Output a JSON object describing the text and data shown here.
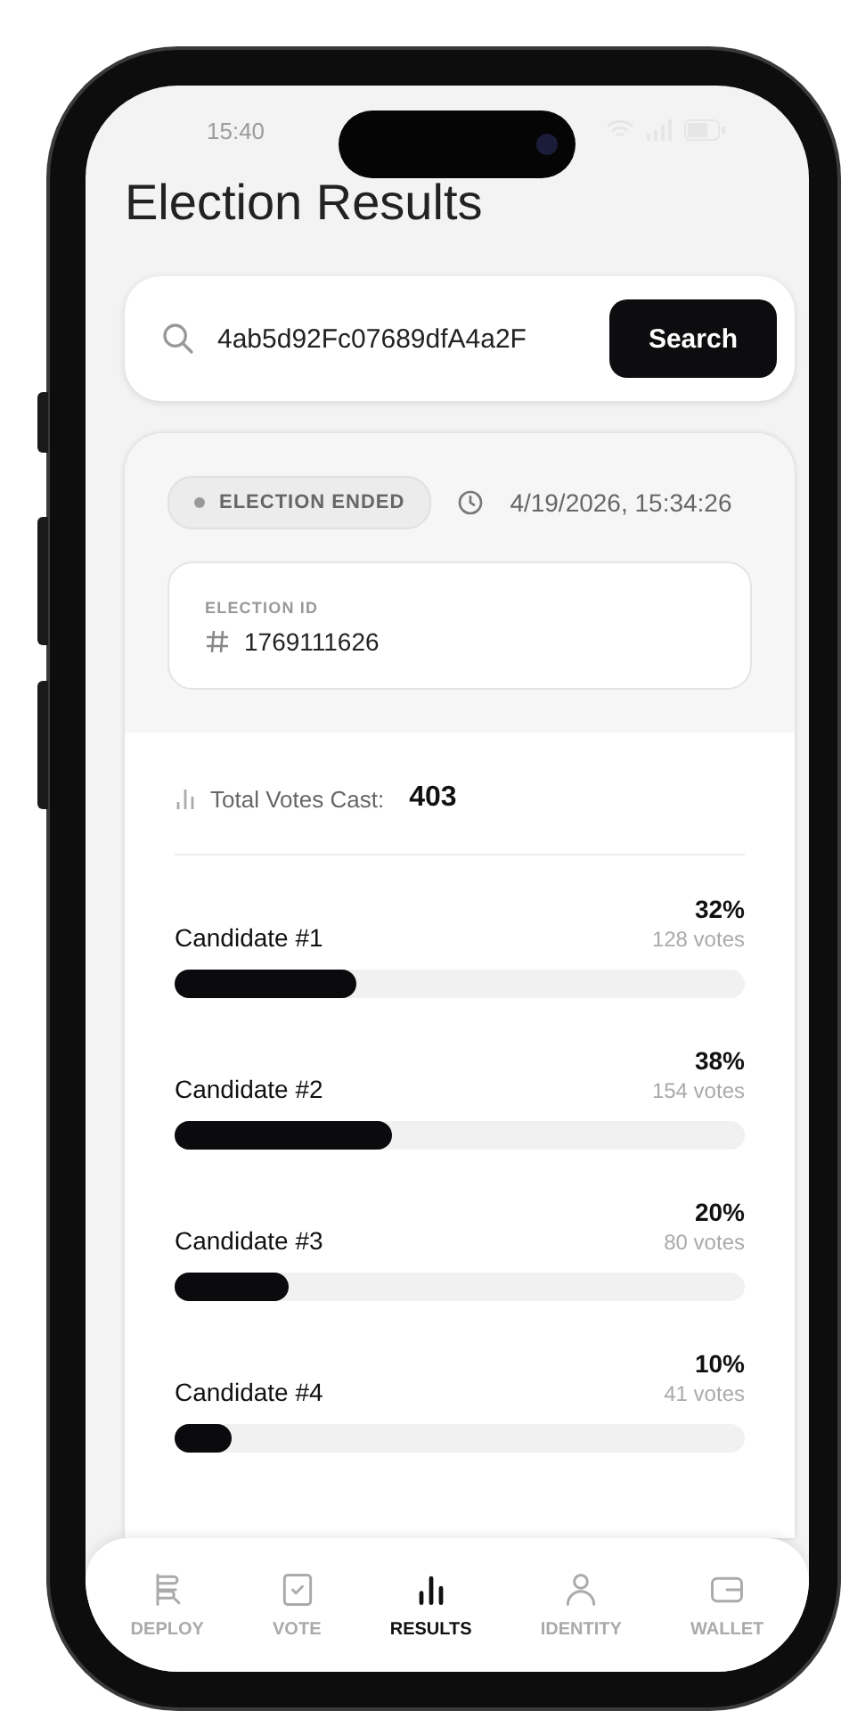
{
  "status_bar": {
    "time": "15:40"
  },
  "title": "Election Results",
  "search": {
    "value": "4ab5d92Fc07689dfA4a2F",
    "button": "Search"
  },
  "election": {
    "status": {
      "kind": "ended",
      "label": "ELECTION ENDED"
    },
    "ended_at": "4/19/2026, 15:34:26",
    "id_label": "ELECTION ID",
    "id_value": "1769111626"
  },
  "total": {
    "label": "Total Votes Cast:",
    "value": "403"
  },
  "candidates": [
    {
      "name": "Candidate #1",
      "percent": "32%",
      "votes": "128 votes",
      "level": 0.32
    },
    {
      "name": "Candidate #2",
      "percent": "38%",
      "votes": "154 votes",
      "level": 0.38
    },
    {
      "name": "Candidate #3",
      "percent": "20%",
      "votes": "80 votes",
      "level": 0.2
    },
    {
      "name": "Candidate #4",
      "percent": "10%",
      "votes": "41 votes",
      "level": 0.1
    }
  ],
  "nav": [
    {
      "kind": "deploy",
      "label": "DEPLOY",
      "selected": false
    },
    {
      "kind": "vote",
      "label": "VOTE",
      "selected": false
    },
    {
      "kind": "results",
      "label": "RESULTS",
      "selected": true
    },
    {
      "kind": "identity",
      "label": "IDENTITY",
      "selected": false
    },
    {
      "kind": "wallet",
      "label": "WALLET",
      "selected": false
    }
  ]
}
